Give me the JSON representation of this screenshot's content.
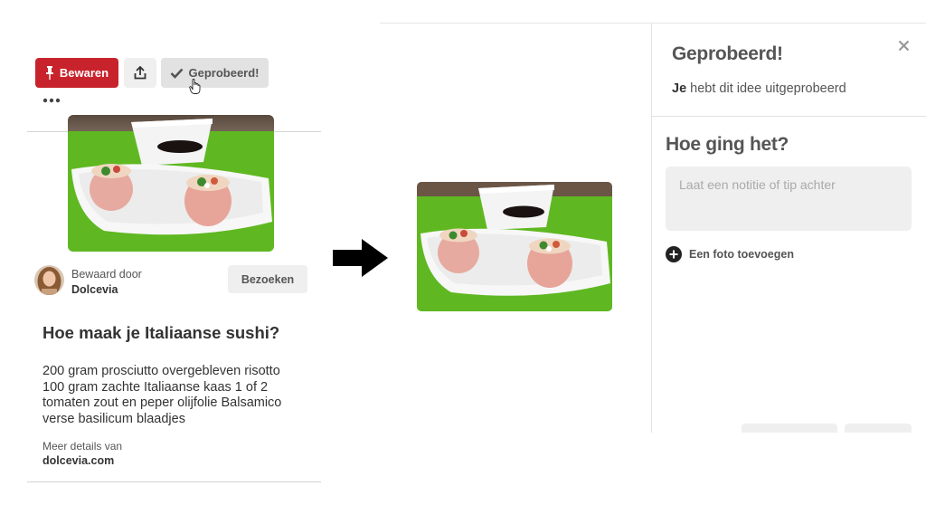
{
  "pin": {
    "save_label": "Bewaren",
    "tried_label": "Geprobeerd!",
    "saved_by_label": "Bewaard door",
    "saved_by_user": "Dolcevia",
    "visit_label": "Bezoeken",
    "title": "Hoe maak je Italiaanse sushi?",
    "description": "200 gram prosciutto overgebleven risotto 100 gram zachte Italiaanse kaas 1 of 2 tomaten zout en peper olijfolie Balsamico verse basilicum blaadjes",
    "details_label": "Meer details van",
    "details_link": "dolcevia.com"
  },
  "modal": {
    "title": "Geprobeerd!",
    "subtitle_bold": "Je",
    "subtitle_rest": " hebt dit idee uitgeprobeerd",
    "how_heading": "Hoe ging het?",
    "note_placeholder": "Laat een notitie of tip achter",
    "add_photo_label": "Een foto toevoegen"
  },
  "colors": {
    "save_red": "#c8232c",
    "button_gray": "#efefef"
  },
  "icons": [
    "pin-icon",
    "share-icon",
    "check-icon",
    "hand-cursor-icon",
    "ellipsis-icon",
    "arrow-right-icon",
    "close-icon",
    "plus-circle-icon"
  ]
}
